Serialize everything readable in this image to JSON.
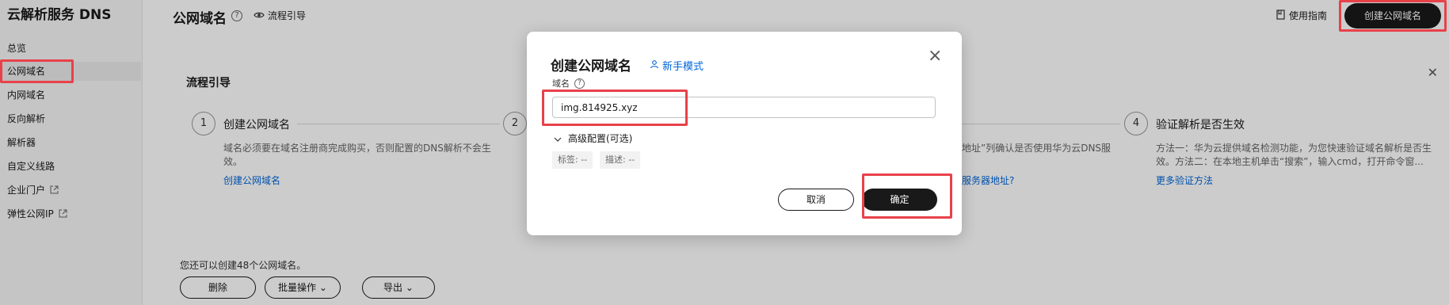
{
  "sidebar": {
    "brand": "云解析服务 DNS",
    "items": [
      {
        "label": "总览"
      },
      {
        "label": "公网域名"
      },
      {
        "label": "内网域名"
      },
      {
        "label": "反向解析"
      },
      {
        "label": "解析器"
      },
      {
        "label": "自定义线路"
      },
      {
        "label": "企业门户"
      },
      {
        "label": "弹性公网IP"
      }
    ],
    "active_index": 1
  },
  "header": {
    "title": "公网域名",
    "help_symbol": "?",
    "flow_link": "流程引导",
    "guide_link": "使用指南",
    "create_button": "创建公网域名"
  },
  "flow": {
    "title": "流程引导",
    "steps": [
      {
        "num": "1",
        "title": "创建公网域名",
        "desc": "域名必须要在域名注册商完成购买，否则配置的DNS解析不会生效。",
        "link": "创建公网域名"
      },
      {
        "num": "2"
      },
      {
        "num": "4",
        "title": "验证解析是否生效",
        "desc": "方法一：华为云提供域名检测功能，为您快速验证域名解析是否生效。方法二：在本地主机单击“搜索”，输入cmd，打开命令窗...",
        "link": "更多验证方法"
      }
    ],
    "step3_partial_desc": "地址”列确认是否使用华为云DNS服",
    "step3_partial_link": "服务器地址?"
  },
  "list": {
    "quota_text": "您还可以创建48个公网域名。",
    "buttons": {
      "delete": "删除",
      "batch": "批量操作",
      "export": "导出"
    }
  },
  "dialog": {
    "title": "创建公网域名",
    "novice_mode": "新手模式",
    "close_symbol": "×",
    "domain_label": "域名",
    "domain_help": "?",
    "domain_value": "img.814925.xyz",
    "advanced_label": "高级配置(可选)",
    "tags": [
      "标签: --",
      "描述: --"
    ],
    "cancel": "取消",
    "confirm": "确定"
  },
  "colors": {
    "accent": "#191919",
    "link": "#0066d9",
    "highlight": "#e8414a"
  }
}
